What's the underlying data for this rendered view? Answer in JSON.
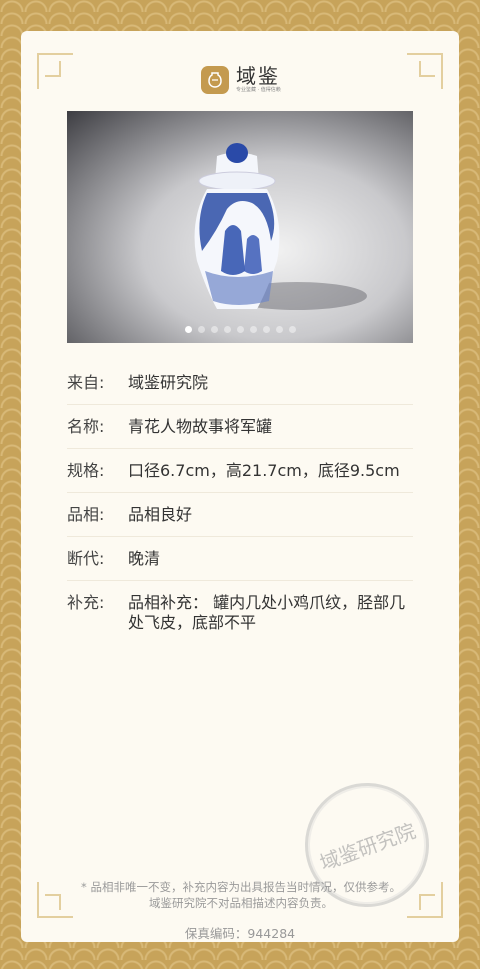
{
  "brand": {
    "name": "域鉴",
    "tagline": "专业鉴藏 · 值得信赖"
  },
  "carousel": {
    "total_dots": 9,
    "active_index": 0
  },
  "details": [
    {
      "label": "来自:",
      "value": "域鉴研究院"
    },
    {
      "label": "名称:",
      "value": "青花人物故事将军罐"
    },
    {
      "label": "规格:",
      "value": "口径6.7cm，高21.7cm，底径9.5cm"
    },
    {
      "label": "品相:",
      "value": "品相良好"
    },
    {
      "label": "断代:",
      "value": "晚清"
    },
    {
      "label": "补充:",
      "value": "品相补充： 罐内几处小鸡爪纹，胫部几处飞皮，底部不平"
    }
  ],
  "seal_text": "域鉴研究院",
  "note": "* 品相非唯一不变，补充内容为出具报告当时情况，仅供参考。域鉴研究院不对品相描述内容负责。",
  "code": "保真编码：944284",
  "colors": {
    "frame": "#c7a35a",
    "card": "#fdfaf2",
    "accent": "#c49a4f",
    "porcelain_blue": "#1f3f9a"
  }
}
